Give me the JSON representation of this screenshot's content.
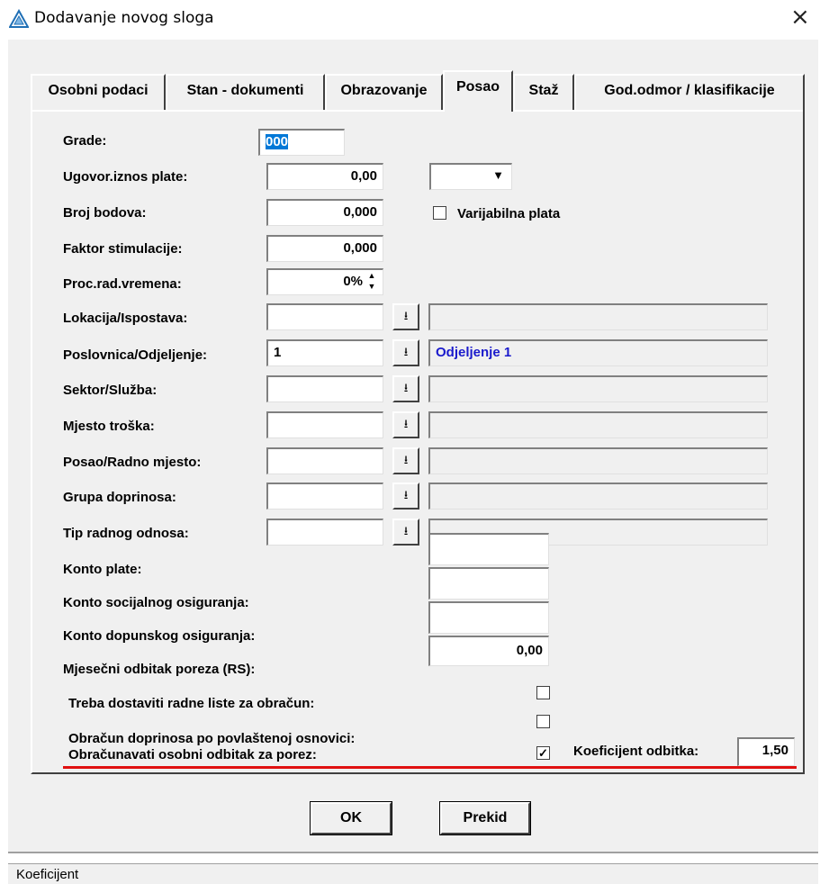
{
  "window": {
    "title": "Dodavanje novog sloga",
    "close_glyph": "×",
    "icon": "app-triangle-icon"
  },
  "tabs": [
    {
      "label": "Osobni podaci"
    },
    {
      "label": "Stan - dokumenti"
    },
    {
      "label": "Obrazovanje"
    },
    {
      "label": "Posao",
      "active": true
    },
    {
      "label": "Staž"
    },
    {
      "label": "God.odmor / klasifikacije"
    }
  ],
  "form": {
    "grade": {
      "label": "Grade:",
      "value": "000"
    },
    "ugovor": {
      "label": "Ugovor.iznos plate:",
      "value": "0,00",
      "currency": ""
    },
    "bodovi": {
      "label": "Broj bodova:",
      "value": "0,000"
    },
    "varijabilna": {
      "label": "Varijabilna plata",
      "checked": false
    },
    "faktor": {
      "label": "Faktor stimulacije:",
      "value": "0,000"
    },
    "proc": {
      "label": "Proc.rad.vremena:",
      "value": "0%"
    },
    "lokacija": {
      "label": "Lokacija/Ispostava:",
      "code": "",
      "name": ""
    },
    "poslovnica": {
      "label": "Poslovnica/Odjeljenje:",
      "code": "1",
      "name": "Odjeljenje 1"
    },
    "sektor": {
      "label": "Sektor/Služba:",
      "code": "",
      "name": ""
    },
    "mjesto": {
      "label": "Mjesto troška:",
      "code": "",
      "name": ""
    },
    "radno": {
      "label": "Posao/Radno mjesto:",
      "code": "",
      "name": ""
    },
    "grupa": {
      "label": "Grupa doprinosa:",
      "code": "",
      "name": ""
    },
    "tip": {
      "label": "Tip radnog odnosa:",
      "code": "",
      "name": ""
    },
    "konto_plate": {
      "label": "Konto plate:",
      "value": ""
    },
    "konto_soc": {
      "label": "Konto socijalnog osiguranja:",
      "value": ""
    },
    "konto_dop": {
      "label": "Konto dopunskog osiguranja:",
      "value": ""
    },
    "odbitak_rs": {
      "label": "Mjesečni odbitak poreza (RS):",
      "value": "0,00"
    },
    "radne_liste": {
      "label": "Treba dostaviti radne liste za obračun:",
      "checked": false
    },
    "povlastena": {
      "label": "Obračun doprinosa po povlaštenoj osnovici:",
      "checked": false
    },
    "osobni_odbitak": {
      "label": "Obračunavati osobni odbitak za porez:",
      "checked": true
    },
    "koeficijent": {
      "label": "Koeficijent odbitka:",
      "value": "1,50"
    }
  },
  "buttons": {
    "ok": "OK",
    "cancel": "Prekid"
  },
  "status": {
    "text": "Koeficijent"
  },
  "glyphs": {
    "dropdown": "▼",
    "lookup": "⭳",
    "spin_up": "▲",
    "spin_down": "▼",
    "check": "✓"
  },
  "colors": {
    "highlight": "#e01010",
    "link_blue": "#1a1acc",
    "selection": "#0078d7"
  }
}
